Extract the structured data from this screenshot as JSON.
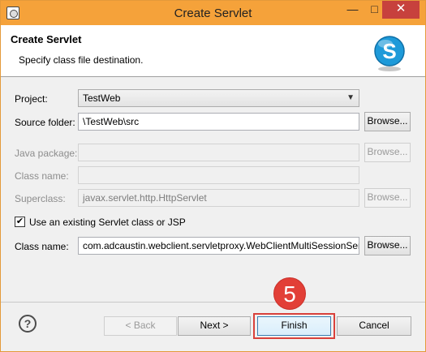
{
  "window": {
    "title": "Create Servlet",
    "minimize": "—",
    "maximize": "□",
    "close": "✕"
  },
  "banner": {
    "title": "Create Servlet",
    "subtitle": "Specify class file destination.",
    "logo_letter": "S"
  },
  "form": {
    "project_label": "Project:",
    "project_value": "TestWeb",
    "source_folder_label": "Source folder:",
    "source_folder_value": "\\TestWeb\\src",
    "java_package_label": "Java package:",
    "java_package_value": "",
    "class_name_label_disabled": "Class name:",
    "class_name_value_disabled": "",
    "superclass_label": "Superclass:",
    "superclass_value": "javax.servlet.http.HttpServlet",
    "use_existing_label": "Use an existing Servlet class or JSP",
    "use_existing_checked": "✔",
    "class_name_label": "Class name:",
    "class_name_value": "com.adcaustin.webclient.servletproxy.WebClientMultiSessionSer",
    "browse_label": "Browse..."
  },
  "footer": {
    "help_icon": "?",
    "back_label": "< Back",
    "next_label": "Next >",
    "finish_label": "Finish",
    "cancel_label": "Cancel"
  },
  "annotation": {
    "step_number": "5"
  },
  "colors": {
    "titlebar": "#f5a23a",
    "close_button": "#c7413d",
    "highlight": "#d9413b",
    "logo_blue": "#1e9ad9"
  }
}
